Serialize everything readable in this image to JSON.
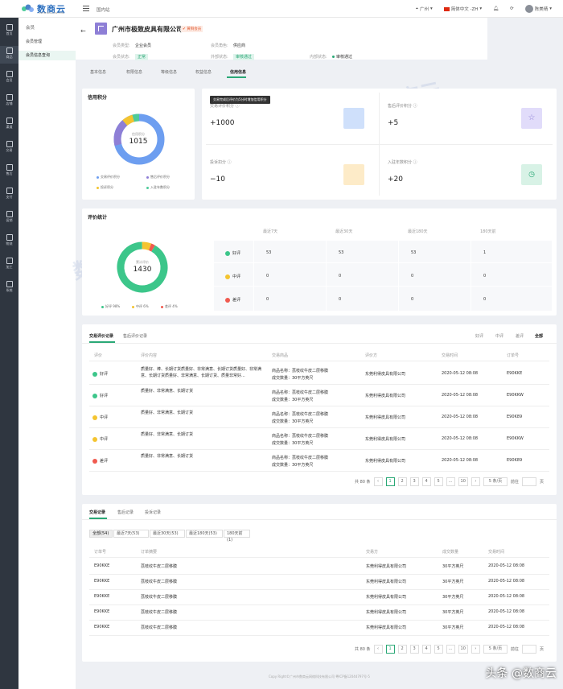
{
  "app": {
    "logo_text": "数商云",
    "logo_sub": "SHUSHANGYUN.COM",
    "top_crumb": "国内站"
  },
  "topbar": {
    "location": "广州",
    "language": "简体中文 -ZH",
    "user": "陈美晴"
  },
  "sidebar": {
    "items": [
      "首页",
      "商品",
      "会员",
      "店铺",
      "渠道",
      "交易",
      "售后",
      "支付",
      "促销",
      "物流",
      "加工",
      "系统"
    ]
  },
  "subnav": {
    "head": "会员",
    "items": [
      "会员管理",
      "会员信息查询"
    ]
  },
  "company": {
    "name": "广州市极致皮具有限公司",
    "badge": "✔ 黄铜会员",
    "fields": {
      "member_type_label": "会员类型:",
      "member_type": "企业会员",
      "member_role_label": "会员角色:",
      "member_role": "供应商",
      "member_status_label": "会员状态:",
      "member_status": "正常",
      "external_status_label": "外部状态:",
      "external_status": "审核通过",
      "internal_status_label": "内部状态:",
      "internal_status": "审核通过"
    }
  },
  "tabs": [
    "基本信息",
    "权限信息",
    "等级信息",
    "权益信息",
    "信用信息"
  ],
  "credit": {
    "title": "信用积分",
    "donut_label": "信用积分",
    "donut_value": "1015",
    "legend": [
      "交易评价积分",
      "售后评价积分",
      "投诉积分",
      "入驻年数积分"
    ],
    "legend_colors": [
      "#6d9ef0",
      "#8e7fd6",
      "#f4c430",
      "#4ecb9a"
    ],
    "tooltip": "交易完成后评价为5分时增加信用积分",
    "kpis": [
      {
        "label": "交易评价积分 ⓘ",
        "value": "+1000",
        "color": "#cfe0fb"
      },
      {
        "label": "售后评价积分 ⓘ",
        "value": "+5",
        "color": "#e1dcfa"
      },
      {
        "label": "投诉扣分 ⓘ",
        "value": "−10",
        "color": "#fdebc8"
      },
      {
        "label": "入驻年数积分 ⓘ",
        "value": "+20",
        "color": "#d8f2e6"
      }
    ]
  },
  "eval_stats": {
    "title": "评价统计",
    "donut_label": "累计评价",
    "donut_value": "1430",
    "legend": [
      "好评 98%",
      "中评 6%",
      "差评 4%"
    ],
    "legend_colors": [
      "#3cc68a",
      "#f4c430",
      "#f05a4f"
    ],
    "columns": [
      "最近7天",
      "最近30天",
      "最近180天",
      "180天前"
    ],
    "rows": [
      {
        "label": "好评",
        "values": [
          "53",
          "53",
          "53",
          "1"
        ]
      },
      {
        "label": "中评",
        "values": [
          "0",
          "0",
          "0",
          "0"
        ]
      },
      {
        "label": "差评",
        "values": [
          "0",
          "0",
          "0",
          "0"
        ]
      }
    ]
  },
  "eval_records": {
    "tabs": [
      "交易评价记录",
      "售后评价记录"
    ],
    "filters": [
      "好评",
      "中评",
      "差评",
      "全部"
    ],
    "columns": [
      "评价",
      "评价内容",
      "交易商品",
      "评价方",
      "交易时间",
      "订单号"
    ],
    "rows": [
      {
        "rating": "好评",
        "content": "质量好、棒、长期订货质量好、非常满意、长期订货质量好、非常满意、长期订货质量好、非常满意、长期订货、质量非常好...",
        "product": "商品名称：荔枝纹牛皮二层移膜",
        "qty": "成交数量：30平方英尺",
        "buyer": "东莞利得皮具有限公司",
        "time": "2020-05-12 08:08",
        "order": "E90KKE"
      },
      {
        "rating": "好评",
        "content": "质量好、非常满意、长期订货",
        "product": "商品名称：荔枝纹牛皮二层移膜",
        "qty": "成交数量：30平方英尺",
        "buyer": "东莞利得皮具有限公司",
        "time": "2020-05-12 08:08",
        "order": "E90KKW"
      },
      {
        "rating": "中评",
        "content": "质量好、非常满意、长期订货",
        "product": "商品名称：荔枝纹牛皮二层移膜",
        "qty": "成交数量：30平方英尺",
        "buyer": "东莞利得皮具有限公司",
        "time": "2020-05-12 08:08",
        "order": "E90K89"
      },
      {
        "rating": "中评",
        "content": "质量好、非常满意、长期订货",
        "product": "商品名称：荔枝纹牛皮二层移膜",
        "qty": "成交数量：30平方英尺",
        "buyer": "东莞利得皮具有限公司",
        "time": "2020-05-12 08:08",
        "order": "E90KKW"
      },
      {
        "rating": "差评",
        "content": "质量好、非常满意、长期订货",
        "product": "商品名称：荔枝纹牛皮二层移膜",
        "qty": "成交数量：30平方英尺",
        "buyer": "东莞利得皮具有限公司",
        "time": "2020-05-12 08:08",
        "order": "E90K89"
      }
    ],
    "pager": {
      "total": "共 80 条",
      "pages": [
        "1",
        "2",
        "3",
        "4",
        "5",
        "...",
        "10"
      ],
      "size": "5 条/页",
      "goto": "前往",
      "unit": "页"
    }
  },
  "trade_records": {
    "tabs": [
      "交易记录",
      "售后记录",
      "投诉记录"
    ],
    "chips": [
      "全部(54)",
      "最近7天(53)",
      "最近30天(53)",
      "最近180天(53)",
      "180天前(1)"
    ],
    "columns": [
      "订单号",
      "订单摘要",
      "交易方",
      "成交数量",
      "交易时间"
    ],
    "rows": [
      {
        "order": "E90KKE",
        "summary": "荔枝纹牛皮二层移膜",
        "party": "东莞利得皮具有限公司",
        "qty": "30平方英尺",
        "time": "2020-05-12 08:08"
      },
      {
        "order": "E90KKE",
        "summary": "荔枝纹牛皮二层移膜",
        "party": "东莞利得皮具有限公司",
        "qty": "30平方英尺",
        "time": "2020-05-12 08:08"
      },
      {
        "order": "E90KKE",
        "summary": "荔枝纹牛皮二层移膜",
        "party": "东莞利得皮具有限公司",
        "qty": "30平方英尺",
        "time": "2020-05-12 08:08"
      },
      {
        "order": "E90KKE",
        "summary": "荔枝纹牛皮二层移膜",
        "party": "东莞利得皮具有限公司",
        "qty": "30平方英尺",
        "time": "2020-05-12 08:08"
      },
      {
        "order": "E90KKE",
        "summary": "荔枝纹牛皮二层移膜",
        "party": "东莞利得皮具有限公司",
        "qty": "30平方英尺",
        "time": "2020-05-12 08:08"
      }
    ],
    "pager": {
      "total": "共 80 条",
      "pages": [
        "1",
        "2",
        "3",
        "4",
        "5",
        "...",
        "10"
      ],
      "size": "5 条/页",
      "goto": "前往",
      "unit": "页"
    }
  },
  "footer": "Copy Right©广州市数商云网络科技有限公司 粤ICP备12044797号-5",
  "overlay_watermark": "头条 @数商云"
}
